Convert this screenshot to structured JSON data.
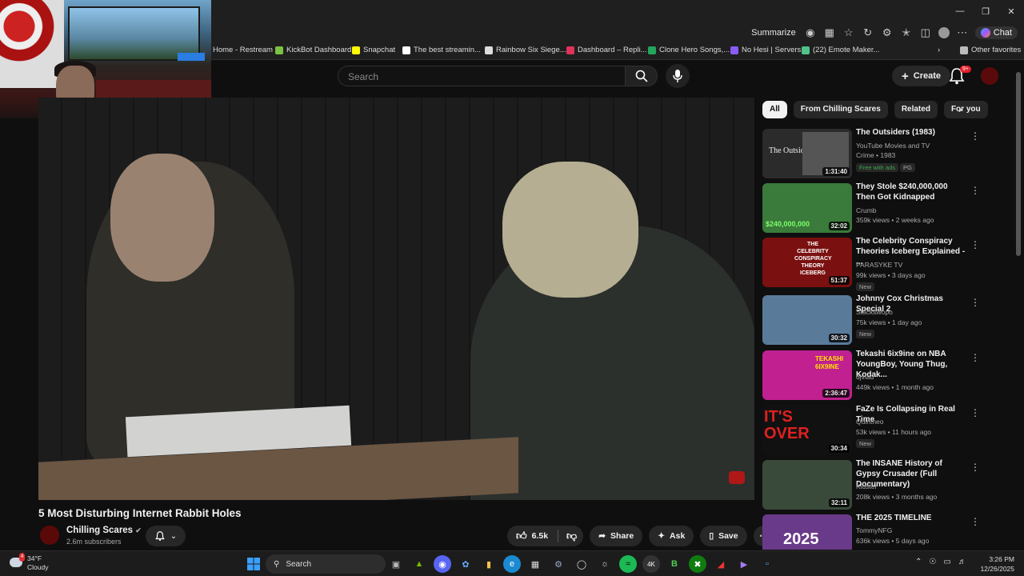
{
  "browser": {
    "summarize_label": "Summarize",
    "chat_label": "Chat",
    "bookmarks": [
      {
        "label": "Home - Restream",
        "color": "#1f1f1f"
      },
      {
        "label": "KickBot Dashboard",
        "color": "#7bc142"
      },
      {
        "label": "Snapchat",
        "color": "#fffc00"
      },
      {
        "label": "The best streamin...",
        "color": "#ffffff"
      },
      {
        "label": "Rainbow Six Siege...",
        "color": "#dddddd"
      },
      {
        "label": "Dashboard – Repli...",
        "color": "#e0325a"
      },
      {
        "label": "Clone Hero Songs,...",
        "color": "#22a55c"
      },
      {
        "label": "No Hesi | Servers",
        "color": "#8a5cf5"
      },
      {
        "label": "(22) Emote Maker...",
        "color": "#4fc38a"
      }
    ],
    "other_favorites": "Other favorites"
  },
  "youtube": {
    "search_placeholder": "Search",
    "create_label": "Create",
    "notif_badge": "9+",
    "video": {
      "title": "5 Most Disturbing Internet Rabbit Holes",
      "channel": "Chilling Scares",
      "subscribers": "2.6m subscribers",
      "likes": "6.5k",
      "share": "Share",
      "ask": "Ask",
      "save": "Save"
    },
    "chips": [
      "All",
      "From Chilling Scares",
      "Related",
      "For you"
    ],
    "recommendations": [
      {
        "title": "The Outsiders (1983)",
        "meta1": "YouTube Movies and TV",
        "meta2": "Crime • 1983",
        "duration": "1:31:40",
        "tag": "Free with ads",
        "tag2": "PG",
        "thumb": "#2b2b2b"
      },
      {
        "title": "They Stole $240,000,000 Then Got Kidnapped",
        "meta1": "Crumb",
        "meta2": "359k views • 2 weeks ago",
        "duration": "32:02",
        "tag": "",
        "thumb": "#3a7a3a"
      },
      {
        "title": "The Celebrity Conspiracy Theories Iceberg Explained - ...",
        "meta1": "PARASYKE TV",
        "meta2": "99k views • 3 days ago",
        "duration": "51:37",
        "tag": "New",
        "thumb": "#7a1010"
      },
      {
        "title": "Johnny Cox Christmas Special 2",
        "meta1": "Stackswopo",
        "meta2": "75k views • 1 day ago",
        "duration": "30:32",
        "tag": "New",
        "thumb": "#5a7a9a"
      },
      {
        "title": "Tekashi 6ix9ine on NBA YoungBoy, Young Thug, Kodak...",
        "meta1": "djvlad",
        "meta2": "449k views • 1 month ago",
        "duration": "2:36:47",
        "tag": "",
        "thumb": "#c02090"
      },
      {
        "title": "FaZe Is Collapsing in Real Time",
        "meta1": "Quintheo",
        "meta2": "53k views • 11 hours ago",
        "duration": "30:34",
        "tag": "New",
        "thumb": "#111111"
      },
      {
        "title": "The INSANE History of Gypsy Crusader (Full Documentary)",
        "meta1": "Kluster",
        "meta2": "208k views • 3 months ago",
        "duration": "32:11",
        "tag": "",
        "thumb": "#3a4a3a"
      },
      {
        "title": "THE 2025 TIMELINE",
        "meta1": "TommyNFG",
        "meta2": "636k views • 5 days ago",
        "duration": "",
        "tag": "",
        "thumb": "#6a3a8a"
      }
    ],
    "thumb_texts": {
      "outsiders": "The Outsiders",
      "stole": "$240,000,000",
      "iceberg": "THE CELEBRITY CONSPIRACY THEORY ICEBERG",
      "tekashi": "TEKASHI 6IX9INE",
      "over": "IT'S OVER",
      "year": "2025"
    }
  },
  "taskbar": {
    "weather_temp": "34°F",
    "weather_desc": "Cloudy",
    "weather_badge": "4",
    "search_label": "Search",
    "time": "3:26 PM",
    "date": "12/26/2025"
  }
}
